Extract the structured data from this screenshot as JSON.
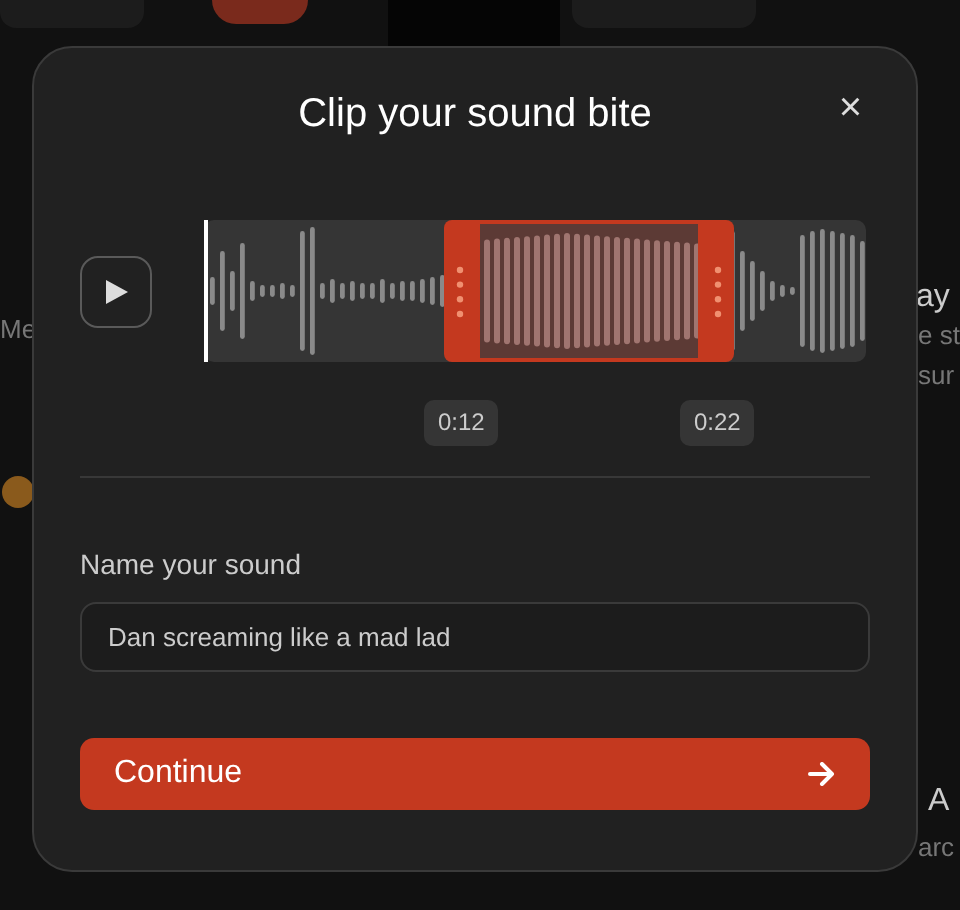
{
  "background": {
    "left_card_text": "Me",
    "right_card_title": "ay",
    "right_card_lines": [
      "e st",
      "sur"
    ],
    "lower_card_title": "A",
    "lower_card_text": "arc"
  },
  "dialog": {
    "title": "Clip your sound bite",
    "close": "×",
    "start_time": "0:12",
    "end_time": "0:22",
    "name_label": "Name your sound",
    "name_value": "Dan screaming like a mad lad",
    "continue": "Continue"
  }
}
